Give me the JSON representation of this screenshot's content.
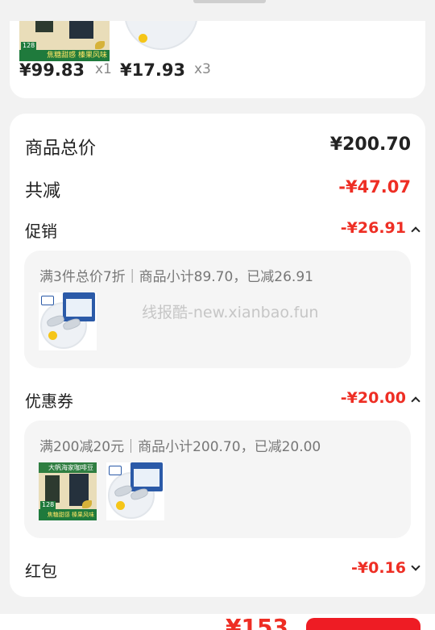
{
  "order_items": {
    "items": [
      {
        "price": "¥99.83",
        "qty": "x1",
        "thumb_icon": "coffee-bean-product-image",
        "thumb_text": {
          "price_tag": "128",
          "banner": "焦糖甜感 榛果风味"
        }
      },
      {
        "price": "¥17.93",
        "qty": "x3",
        "thumb_icon": "shrimp-product-image"
      }
    ]
  },
  "summary": {
    "total_label": "商品总价",
    "total_value": "¥200.70",
    "reduce_label": "共减",
    "reduce_value": "-¥47.07"
  },
  "promotion": {
    "label": "促销",
    "value": "-¥26.91",
    "detail": "满3件总价7折｜商品小计89.70，已减26.91",
    "watermark": "线报酷-new.xianbao.fun"
  },
  "coupon": {
    "label": "优惠券",
    "value": "-¥20.00",
    "detail": "满200减20元｜商品小计200.70，已减20.00",
    "coffee_title": "大帆海家咖啡豆",
    "coffee_price_tag": "128",
    "coffee_banner": "焦糖甜感 榛果风味"
  },
  "red_packet": {
    "label": "红包",
    "value": "-¥0.16"
  },
  "footer": {
    "pay_amount": "¥153"
  },
  "colors": {
    "accent_red": "#ee2e24",
    "background": "#f2f2f2"
  }
}
